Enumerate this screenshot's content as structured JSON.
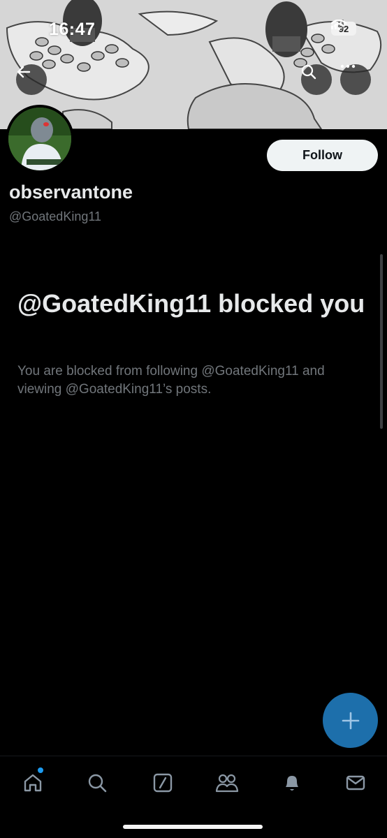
{
  "status_bar": {
    "time": "16:47",
    "battery": "92"
  },
  "header": {
    "back_icon": "arrow-left-icon",
    "search_icon": "search-icon",
    "more_icon": "more-horizontal-icon"
  },
  "profile": {
    "display_name": "observantone",
    "handle": "@GoatedKing11",
    "follow_label": "Follow"
  },
  "blocked_notice": {
    "title": "@GoatedKing11 blocked you",
    "description": "You are blocked from following @GoatedKing11 and viewing @GoatedKing11’s posts."
  },
  "fab": {
    "icon": "plus-icon",
    "color": "#1d6fab"
  },
  "bottom_nav": {
    "items": [
      {
        "name": "home",
        "icon": "home-icon",
        "active": true,
        "has_notification_dot": true
      },
      {
        "name": "search",
        "icon": "search-icon"
      },
      {
        "name": "grok",
        "icon": "slash-box-icon"
      },
      {
        "name": "communities",
        "icon": "people-icon"
      },
      {
        "name": "notifications",
        "icon": "bell-icon"
      },
      {
        "name": "messages",
        "icon": "envelope-icon"
      }
    ]
  },
  "colors": {
    "background": "#000000",
    "primary_text": "#e7e9ea",
    "secondary_text": "#71767b",
    "accent": "#1d9bf0"
  }
}
